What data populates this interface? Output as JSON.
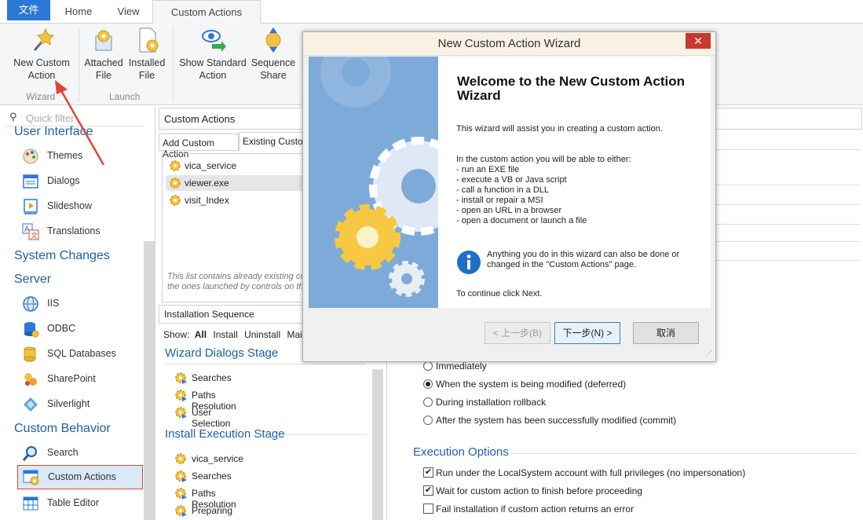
{
  "tabs": {
    "file": "文件",
    "home": "Home",
    "view": "View",
    "custom_actions": "Custom Actions"
  },
  "ribbon": {
    "new_custom_action": "New Custom\nAction",
    "attached_file": "Attached\nFile",
    "installed_file": "Installed\nFile",
    "show_standard_action": "Show Standard\nAction",
    "sequence_share": "Sequence\nShare",
    "group_wizard": "Wizard",
    "group_launch": "Launch"
  },
  "leftnav": {
    "search_placeholder": "Quick filter",
    "sections": {
      "user_interface": "User Interface",
      "system_changes": "System Changes",
      "server": "Server",
      "custom_behavior": "Custom Behavior"
    },
    "items": {
      "themes": "Themes",
      "dialogs": "Dialogs",
      "slideshow": "Slideshow",
      "translations": "Translations",
      "iis": "IIS",
      "odbc": "ODBC",
      "sql_databases": "SQL Databases",
      "sharepoint": "SharePoint",
      "silverlight": "Silverlight",
      "search": "Search",
      "custom_actions": "Custom Actions",
      "table_editor": "Table Editor"
    }
  },
  "midpanel": {
    "header": "Custom Actions",
    "tab_add": "Add Custom Action",
    "tab_existing": "Existing Custom",
    "list": [
      "vica_service",
      "viewer.exe",
      "visit_Index"
    ],
    "note_line1": "This list contains already existing cu",
    "note_line2": "the ones launched by controls on th",
    "install_seq_header": "Installation Sequence",
    "show_label": "Show:",
    "show_all": "All",
    "show_install": "Install",
    "show_uninstall": "Uninstall",
    "show_maint": "Maint",
    "stage1": "Wizard Dialogs Stage",
    "stage1_items": [
      "Searches",
      "Paths Resolution",
      "User Selection"
    ],
    "stage2": "Install Execution Stage",
    "stage2_items": [
      "vica_service",
      "Searches",
      "Paths Resolution",
      "Preparing"
    ]
  },
  "rightpanel": {
    "radios": [
      {
        "label": "Immediately",
        "checked": false
      },
      {
        "label": "When the system is being modified (deferred)",
        "checked": true
      },
      {
        "label": "During installation rollback",
        "checked": false
      },
      {
        "label": "After the system has been successfully modified (commit)",
        "checked": false
      }
    ],
    "exec_options_title": "Execution Options",
    "checks": [
      {
        "label": "Run under the LocalSystem account with full privileges (no impersonation)",
        "checked": true
      },
      {
        "label": "Wait for custom action to finish before proceeding",
        "checked": true
      },
      {
        "label": "Fail installation if custom action returns an error",
        "checked": false
      }
    ]
  },
  "dialog": {
    "title": "New Custom Action Wizard",
    "close": "✕",
    "heading": "Welcome to the New Custom Action Wizard",
    "intro": "This wizard will assist you in creating a custom action.",
    "either": "In the custom action you will be able to either:",
    "bullets": [
      "- run an EXE file",
      "- execute a VB or Java script",
      "- call a function in a DLL",
      "- install or repair a MSI",
      "- open an URL in a browser",
      "- open a document or launch a file"
    ],
    "info_line1": "Anything you do in this wizard can also be done or",
    "info_line2": "changed in the \"Custom Actions\" page.",
    "continue": "To continue click Next.",
    "btn_back": "< 上一步(B)",
    "btn_next": "下一步(N) >",
    "btn_cancel": "取消"
  },
  "colors": {
    "accent": "#2b78d8",
    "section_blue": "#1f5fa8",
    "close_red": "#c9392f",
    "annotation_red": "#e0453a"
  }
}
